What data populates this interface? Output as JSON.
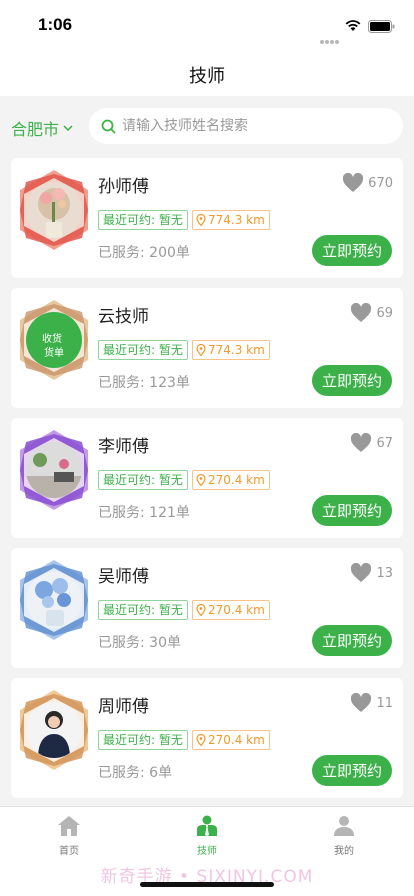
{
  "status_bar": {
    "time": "1:06"
  },
  "nav": {
    "title": "技师"
  },
  "search": {
    "city": "合肥市",
    "placeholder": "请输入技师姓名搜索"
  },
  "colors": {
    "brand_green": "#3cb14a",
    "distance_orange": "#f19a2a"
  },
  "technicians": [
    {
      "name": "孙师傅",
      "likes": "670",
      "available": "最近可约: 暂无",
      "distance": "774.3 km",
      "served": "已服务: 200单",
      "book_label": "立即预约",
      "avatar_icon": "flower-vase-photo"
    },
    {
      "name": "云技师",
      "likes": "69",
      "available": "最近可约: 暂无",
      "distance": "774.3 km",
      "served": "已服务: 123单",
      "book_label": "立即预约",
      "avatar_icon": "green-logo",
      "avatar_text": "收货 货单"
    },
    {
      "name": "李师傅",
      "likes": "67",
      "available": "最近可约: 暂无",
      "distance": "270.4 km",
      "served": "已服务: 121单",
      "book_label": "立即预约",
      "avatar_icon": "room-photo"
    },
    {
      "name": "吴师傅",
      "likes": "13",
      "available": "最近可约: 暂无",
      "distance": "270.4 km",
      "served": "已服务: 30单",
      "book_label": "立即预约",
      "avatar_icon": "blue-flowers-photo"
    },
    {
      "name": "周师傅",
      "likes": "11",
      "available": "最近可约: 暂无",
      "distance": "270.4 km",
      "served": "已服务: 6单",
      "book_label": "立即预约",
      "avatar_icon": "woman-portrait"
    }
  ],
  "tabs": [
    {
      "label": "首页",
      "icon": "home-icon",
      "active": false
    },
    {
      "label": "技师",
      "icon": "technician-icon",
      "active": true
    },
    {
      "label": "我的",
      "icon": "profile-icon",
      "active": false
    }
  ],
  "watermark": "新奇手游 • SIXINYI.COM"
}
